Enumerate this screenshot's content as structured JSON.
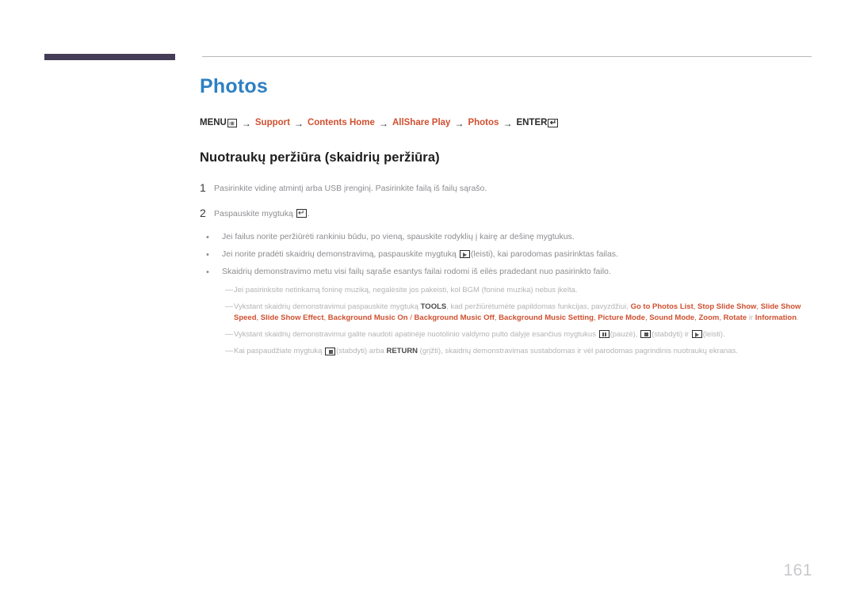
{
  "page": {
    "title": "Photos",
    "number": "161",
    "title_color": "#2e80c2",
    "accent_color": "#cf5030",
    "rule_color": "#453d57",
    "body_text_color": "#8d8d92"
  },
  "breadcrumb": {
    "items": [
      {
        "label": "MENU",
        "style": "dark",
        "icon": "menu-grid-icon"
      },
      {
        "label": "Support",
        "style": "accent",
        "icon": ""
      },
      {
        "label": "Contents Home",
        "style": "accent",
        "icon": ""
      },
      {
        "label": "AllShare Play",
        "style": "accent",
        "icon": ""
      },
      {
        "label": "Photos",
        "style": "accent",
        "icon": ""
      },
      {
        "label": "ENTER",
        "style": "dark",
        "icon": "enter-return-icon"
      }
    ],
    "separator": "→"
  },
  "section": {
    "heading": "Nuotraukų peržiūra (skaidrių peržiūra)",
    "steps": [
      {
        "number": "1",
        "text": "Pasirinkite vidinę atmintį arba USB įrenginį. Pasirinkite failą iš failų sąrašo."
      },
      {
        "number": "2",
        "text_before": "Paspauskite mygtuką ",
        "icon": "enter-return-icon",
        "text_after": "."
      }
    ],
    "bullets": [
      {
        "text": "Jei failus norite peržiūrėti rankiniu būdu, po vieną, spauskite rodyklių į kairę ar dešinę mygtukus."
      },
      {
        "text_before": "Jei norite pradėti skaidrių demonstravimą, paspauskite mygtuką ",
        "icon": "play-button-icon",
        "text_after": "(leisti), kai parodomas pasirinktas failas."
      },
      {
        "text": "Skaidrių demonstravimo metu visi failų sąraše esantys failai rodomi iš eilės pradedant nuo pasirinkto failo."
      }
    ],
    "notes": [
      {
        "id": "note-bgm",
        "dash": "—",
        "text": "Jei pasirinksite netinkamą foninę muziką, negalėsite jos pakeisti, kol BGM (foninė muzika) nebus įkelta."
      },
      {
        "id": "note-tools",
        "dash": "—",
        "text_before": "Vykstant skaidrių demonstravimui paspauskite mygtuką ",
        "tools_label": "TOOLS",
        "text_middle": ", kad peržiūrėtumėte papildomas funkcijas, pavyzdžiui, ",
        "options": [
          "Go to Photos List",
          "Stop Slide Show",
          "Slide Show Speed",
          "Slide Show Effect",
          "Background Music On",
          "Background Music Off",
          "Background Music Setting",
          "Picture Mode",
          "Sound Mode",
          "Zoom",
          "Rotate",
          "Information"
        ],
        "conjunction": " ir ",
        "text_after": "."
      },
      {
        "id": "note-remote",
        "dash": "—",
        "text_before": "Vykstant skaidrių demonstravimui galite naudoti apatinėje nuotolinio valdymo pulto dalyje esančius mygtukus ",
        "icon1": "pause-button-icon",
        "label1": "(pauzė), ",
        "icon2": "stop-button-icon",
        "label2": "(stabdyti) ir ",
        "icon3": "play-button-icon",
        "label3": "(leisti)."
      },
      {
        "id": "note-return",
        "dash": "—",
        "text_before": "Kai paspaudžiate mygtuką ",
        "icon": "stop-button-icon",
        "text_middle": "(stabdyti) arba ",
        "return_label": "RETURN",
        "text_after": " (grįžti), skaidrių demonstravimas sustabdomas ir vėl parodomas pagrindinis nuotraukų ekranas."
      }
    ]
  }
}
